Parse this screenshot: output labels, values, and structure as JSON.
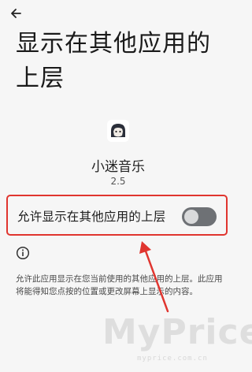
{
  "header": {
    "back_icon": "arrow-left-icon",
    "title": "显示在其他应用的上层"
  },
  "app": {
    "icon": "app-avatar-icon",
    "name": "小迷音乐",
    "version": "2.5"
  },
  "permission": {
    "label": "允许显示在其他应用的上层",
    "enabled": false,
    "highlight_color": "#e0352f"
  },
  "info": {
    "icon": "info-icon",
    "description": "允许此应用显示在您当前使用的其他应用的上层。此应用将能得知您点按的位置或更改屏幕上显示的内容。"
  },
  "watermark": {
    "text": "MyPrice",
    "subtext": "myprice.com.cn"
  },
  "colors": {
    "background": "#f6f6f6",
    "toggle_track_off": "#6e7175",
    "toggle_knob_off": "#d9dadb",
    "annotation": "#e0352f"
  }
}
